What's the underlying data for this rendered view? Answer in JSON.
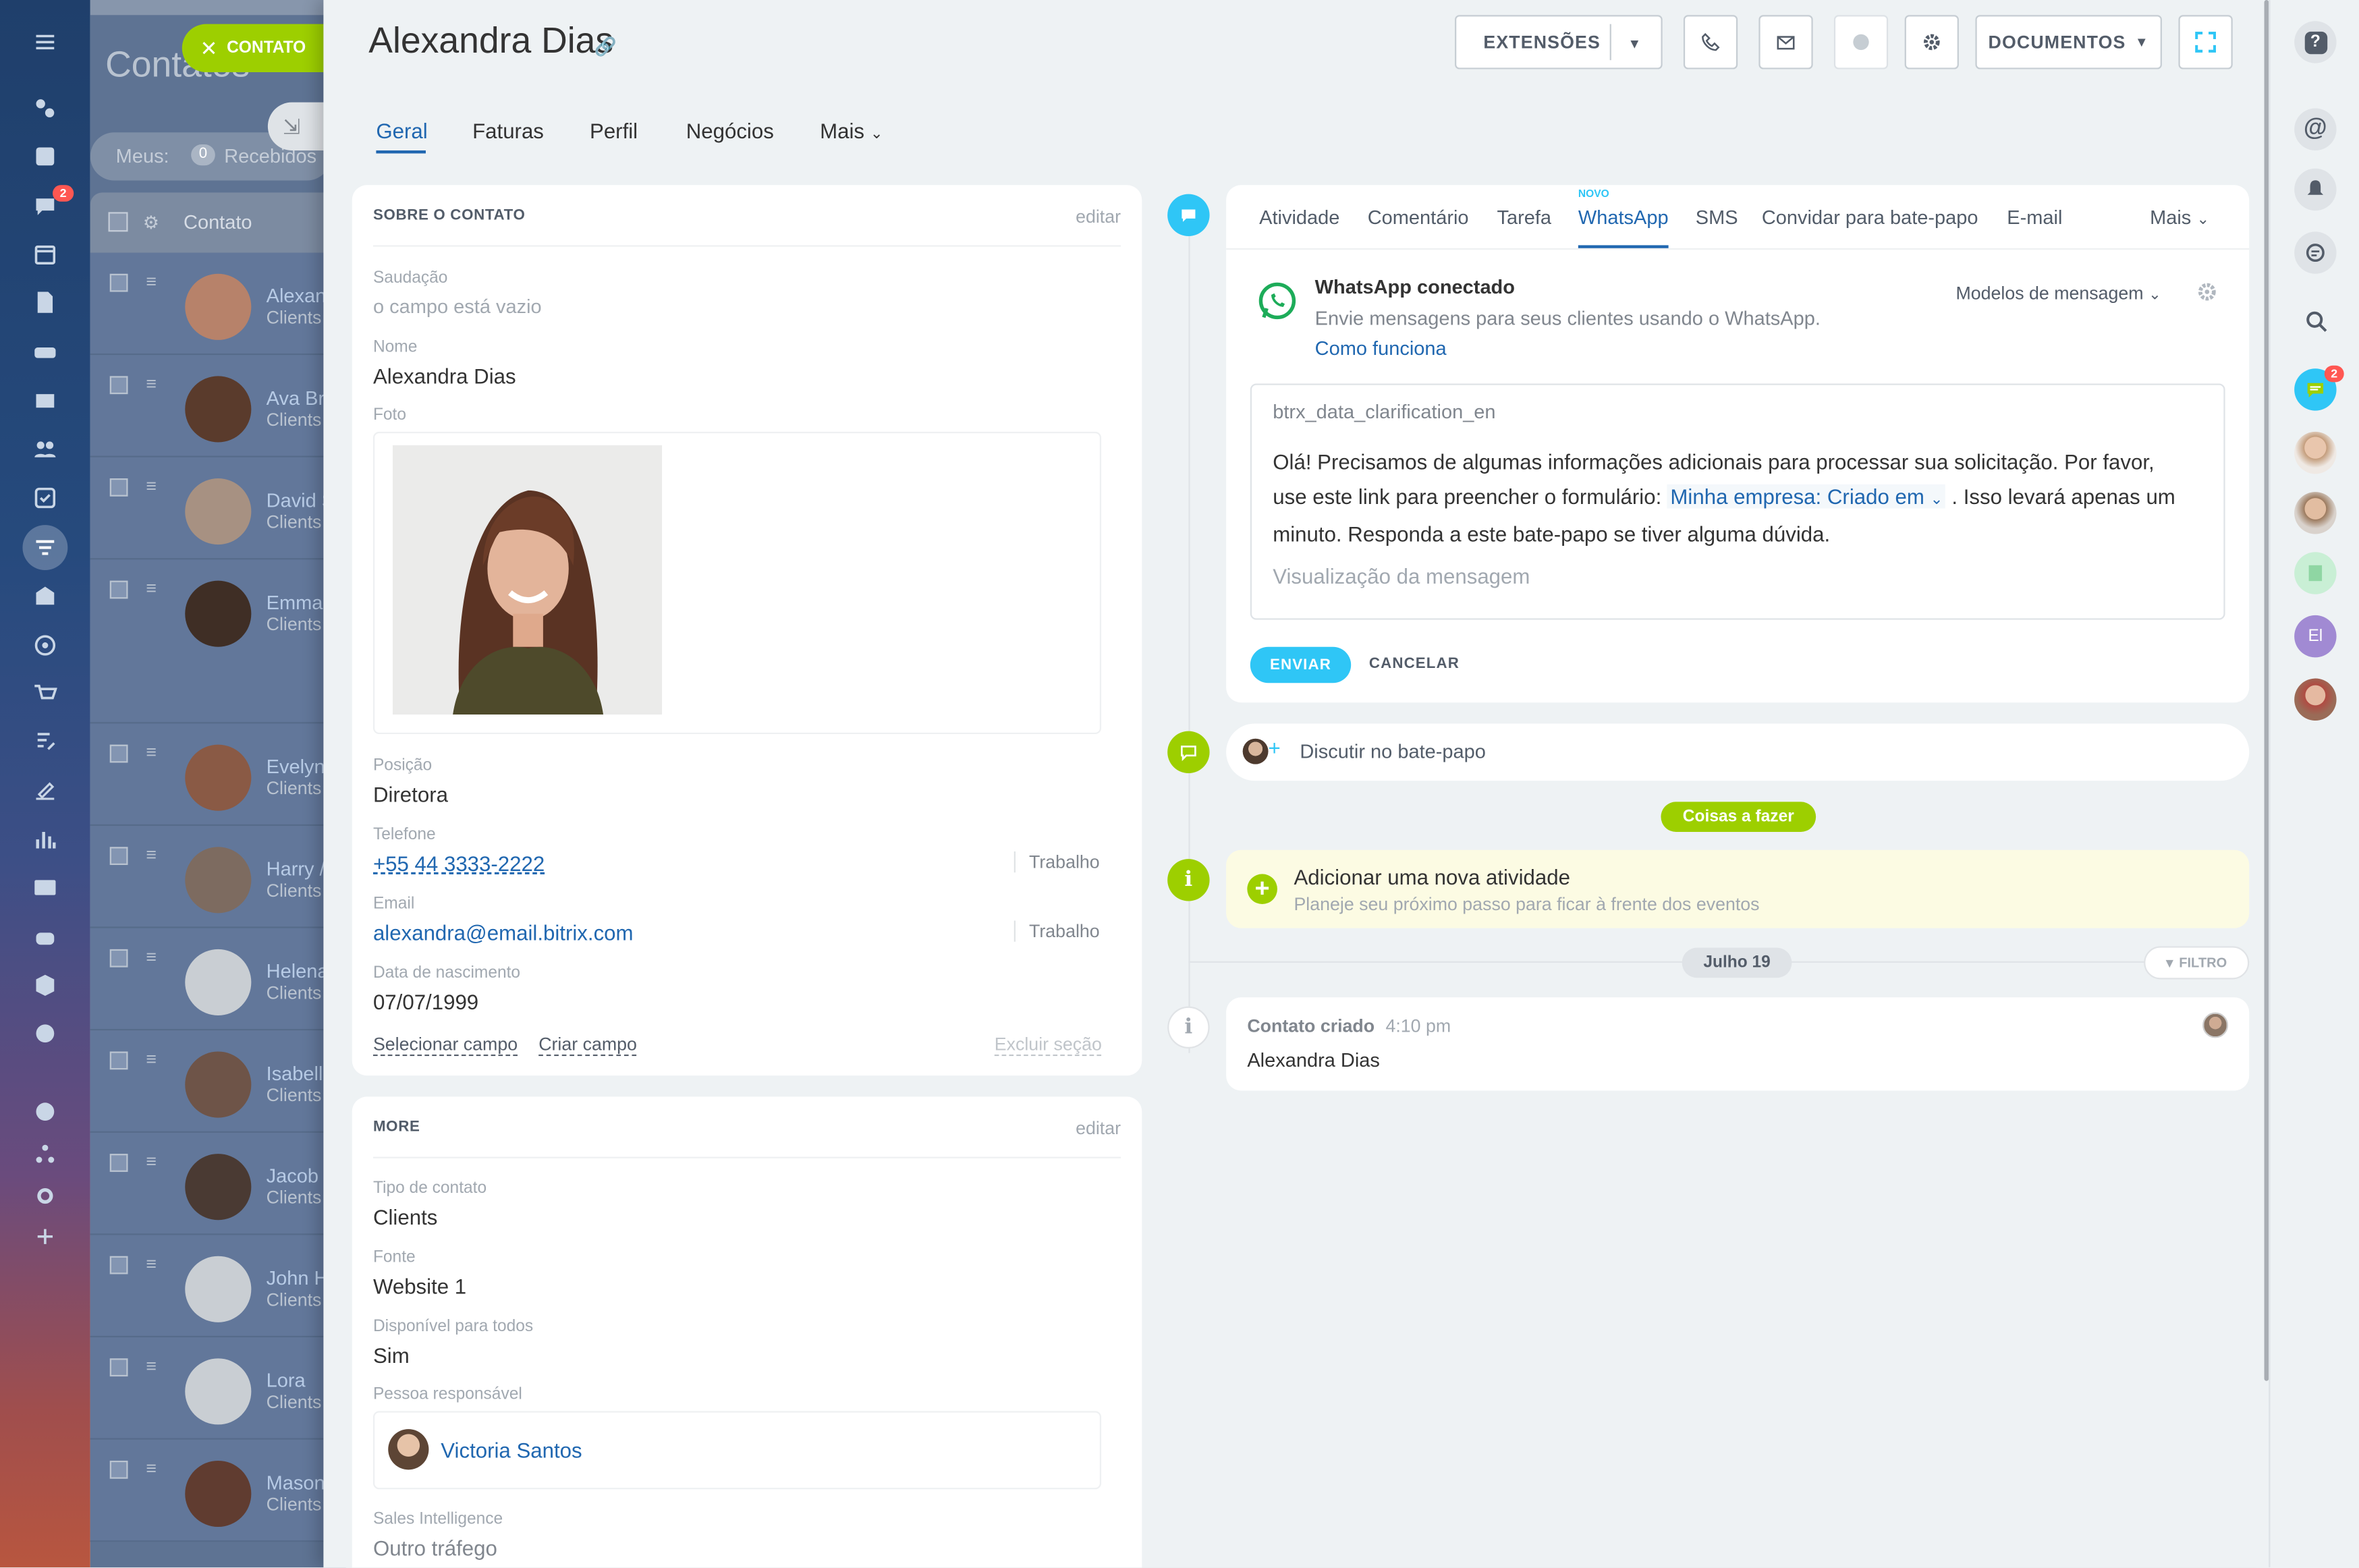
{
  "app": {
    "list_title": "Contatos",
    "contact_button": "CONTATO",
    "filter_mine": "Meus:",
    "filter_count": "0",
    "filter_received": "Recebidos",
    "column_contact": "Contato",
    "list_rows": [
      {
        "name": "Alexan",
        "type": "Clients"
      },
      {
        "name": "Ava Br",
        "type": "Clients"
      },
      {
        "name": "David S",
        "type": "Clients"
      },
      {
        "name": "Emma",
        "type": "Clients"
      },
      {
        "name": "Evelyn",
        "type": "Clients"
      },
      {
        "name": "Harry /",
        "type": "Clients"
      },
      {
        "name": "Helena",
        "type": "Clients"
      },
      {
        "name": "Isabella",
        "type": "Clients"
      },
      {
        "name": "Jacob",
        "type": "Clients"
      },
      {
        "name": "John H",
        "type": "Clients"
      },
      {
        "name": "Lora",
        "type": "Clients"
      },
      {
        "name": "Mason",
        "type": "Clients"
      }
    ],
    "nav_badge": "2"
  },
  "header": {
    "title": "Alexandra Dias",
    "btn_extensions": "EXTENSÕES",
    "btn_documents": "DOCUMENTOS"
  },
  "tabs": [
    "Geral",
    "Faturas",
    "Perfil",
    "Negócios",
    "Mais"
  ],
  "about": {
    "section_title": "SOBRE O CONTATO",
    "edit": "editar",
    "salutation_label": "Saudação",
    "salutation_value": "o campo está vazio",
    "name_label": "Nome",
    "name_value": "Alexandra Dias",
    "photo_label": "Foto",
    "position_label": "Posição",
    "position_value": "Diretora",
    "phone_label": "Telefone",
    "phone_value": "+55 44 3333-2222",
    "phone_type": "Trabalho",
    "email_label": "Email",
    "email_value": "alexandra@email.bitrix.com",
    "email_type": "Trabalho",
    "birth_label": "Data de nascimento",
    "birth_value": "07/07/1999",
    "select_field": "Selecionar campo",
    "create_field": "Criar campo",
    "delete_section": "Excluir seção"
  },
  "more": {
    "section_title": "MORE",
    "edit": "editar",
    "type_label": "Tipo de contato",
    "type_value": "Clients",
    "source_label": "Fonte",
    "source_value": "Website 1",
    "available_label": "Disponível para todos",
    "available_value": "Sim",
    "responsible_label": "Pessoa responsável",
    "responsible_value": "Victoria Santos",
    "si_label": "Sales Intelligence",
    "si_value": "Outro tráfego"
  },
  "timeline": {
    "tabs": [
      "Atividade",
      "Comentário",
      "Tarefa",
      "WhatsApp",
      "SMS",
      "Convidar para bate-papo",
      "E-mail"
    ],
    "tabs_more": "Mais",
    "new_badge": "NOVO",
    "wa_title": "WhatsApp conectado",
    "wa_subtitle": "Envie mensagens para seus clientes usando o WhatsApp.",
    "wa_howto": "Como funciona",
    "templates": "Modelos de mensagem",
    "template_name": "btrx_data_clarification_en",
    "message_part1": "Olá! Precisamos de algumas informações adicionais para processar sua solicitação. Por favor, use este link para preencher o formulário:",
    "message_token": "Minha empresa: Criado em",
    "message_part2": ". Isso levará apenas um minuto. Responda a este bate-papo se tiver alguma dúvida.",
    "preview": "Visualização da mensagem",
    "send": "ENVIAR",
    "cancel": "CANCELAR",
    "discuss": "Discutir no bate-papo",
    "todo_badge": "Coisas a fazer",
    "add_activity": "Adicionar uma nova atividade",
    "add_activity_hint": "Planeje seu próximo passo para ficar à frente dos eventos",
    "date_badge": "Julho 19",
    "filter": "FILTRO",
    "created_title": "Contato criado",
    "created_time": "4:10 pm",
    "created_name": "Alexandra Dias"
  },
  "rightbar": {
    "chat_badge": "2",
    "avatar_initials": "El"
  },
  "colors": {
    "accent_blue": "#2fc6f6",
    "green": "#9dcf00",
    "link": "#2067b0",
    "whatsapp": "#1dac59"
  }
}
